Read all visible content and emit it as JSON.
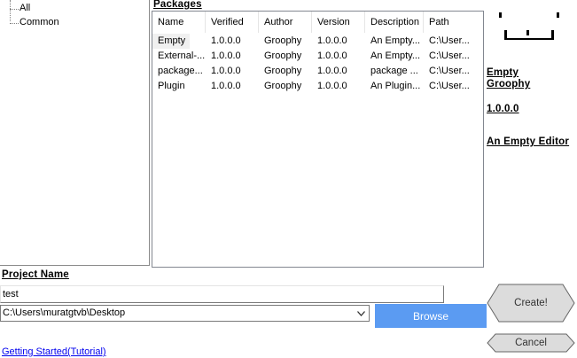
{
  "tree": {
    "items": [
      {
        "label": "All"
      },
      {
        "label": "Common"
      }
    ]
  },
  "packages": {
    "title": "Packages",
    "columns": [
      "Name",
      "Verified",
      "Author",
      "Version",
      "Description",
      "Path"
    ],
    "rows": [
      {
        "name": "Empty",
        "verified": "1.0.0.0",
        "author": "Groophy",
        "version": "1.0.0.0",
        "description": "An Empty...",
        "path": "C:\\User..."
      },
      {
        "name": "External-...",
        "verified": "1.0.0.0",
        "author": "Groophy",
        "version": "1.0.0.0",
        "description": "An Empty...",
        "path": "C:\\User..."
      },
      {
        "name": "package...",
        "verified": "1.0.0.0",
        "author": "Groophy",
        "version": "1.0.0.0",
        "description": "package ...",
        "path": "C:\\User..."
      },
      {
        "name": "Plugin",
        "verified": "1.0.0.0",
        "author": "Groophy",
        "version": "1.0.0.0",
        "description": "An Plugin...",
        "path": "C:\\User..."
      }
    ]
  },
  "details": {
    "name": "Empty",
    "author": "Groophy",
    "version": "1.0.0.0",
    "description": "An Empty Editor"
  },
  "project": {
    "title": "Project Name",
    "name_value": "test",
    "location_value": "C:\\Users\\muratgtvb\\Desktop"
  },
  "buttons": {
    "browse": "Browse",
    "create": "Create!",
    "cancel": "Cancel"
  },
  "link": {
    "getting_started": "Getting Started(Tutorial)"
  },
  "colors": {
    "browse_bg": "#5b9bf2",
    "hex_button_bg": "#dcdcdc",
    "link": "#0000ee"
  }
}
